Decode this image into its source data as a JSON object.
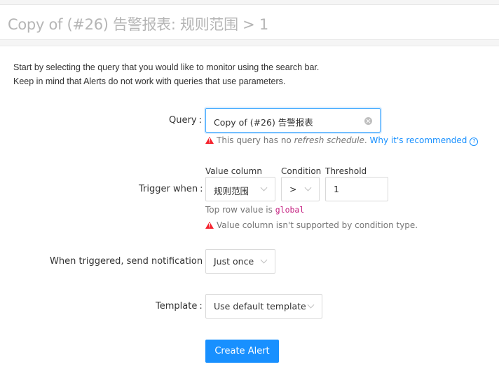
{
  "header": {
    "title": "Copy of (#26) 告警报表: 规则范围 > 1"
  },
  "intro": {
    "line1": "Start by selecting the query that you would like to monitor using the search bar.",
    "line2": "Keep in mind that Alerts do not work with queries that use parameters."
  },
  "query": {
    "label": "Query",
    "value": "Copy of (#26) 告警报表",
    "warning_prefix": "This query has no ",
    "warning_italic": "refresh schedule",
    "warning_suffix": ".",
    "warning_link": "Why it's recommended",
    "help_glyph": "?"
  },
  "trigger": {
    "label": "Trigger when",
    "value_column_label": "Value column",
    "value_column": "规则范围",
    "condition_label": "Condition",
    "condition": ">",
    "threshold_label": "Threshold",
    "threshold": "1",
    "hint_prefix": "Top row value is",
    "hint_code": "global",
    "warning": "Value column isn't supported by condition type."
  },
  "notification": {
    "label": "When triggered, send notification",
    "value": "Just once"
  },
  "template": {
    "label": "Template",
    "value": "Use default template"
  },
  "actions": {
    "create": "Create Alert"
  },
  "colors": {
    "primary": "#1890ff",
    "warning": "#f5222d",
    "code": "#c41d7f"
  },
  "separator": ":"
}
